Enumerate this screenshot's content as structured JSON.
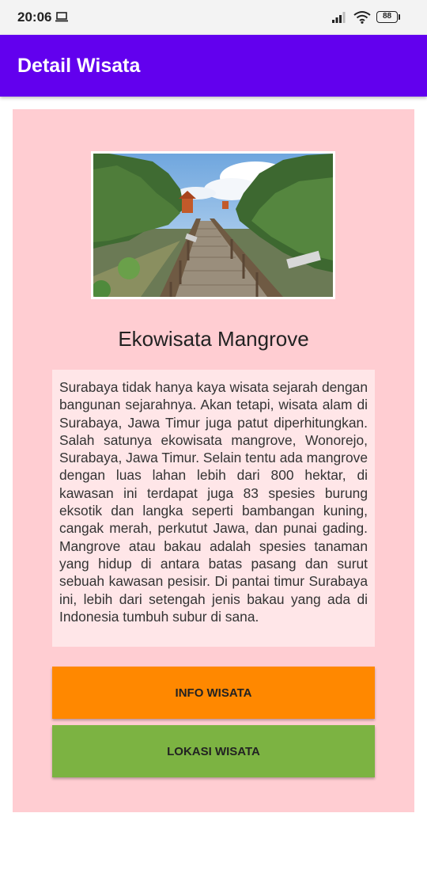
{
  "status_bar": {
    "time": "20:06",
    "battery": "88"
  },
  "app_bar": {
    "title": "Detail Wisata"
  },
  "detail": {
    "image_alt": "Ekowisata Mangrove boardwalk photo",
    "title": "Ekowisata Mangrove",
    "description": "Surabaya tidak hanya kaya wisata sejarah dengan bangunan sejarahnya. Akan tetapi, wisata alam di Surabaya, Jawa Timur juga patut diperhitungkan. Salah satunya ekowisata mangrove, Wonorejo, Surabaya, Jawa Timur. Selain tentu ada mangrove dengan luas lahan lebih dari 800 hektar, di kawasan ini terdapat juga 83 spesies burung eksotik dan langka seperti bambangan kuning, cangak merah, perkutut Jawa, dan punai gading. Mangrove atau bakau adalah spesies tanaman yang hidup di antara batas pasang dan surut sebuah kawasan pesisir. Di pantai timur Surabaya ini, lebih dari setengah jenis bakau yang ada di Indonesia tumbuh subur di sana."
  },
  "buttons": {
    "info_label": "INFO WISATA",
    "lokasi_label": "LOKASI WISATA"
  },
  "colors": {
    "app_bar": "#6200ee",
    "card": "#ffcdd2",
    "info_button": "#ff8800",
    "lokasi_button": "#7cb342"
  },
  "icons": [
    "laptop-icon",
    "signal-icon",
    "wifi-icon",
    "battery-icon"
  ]
}
